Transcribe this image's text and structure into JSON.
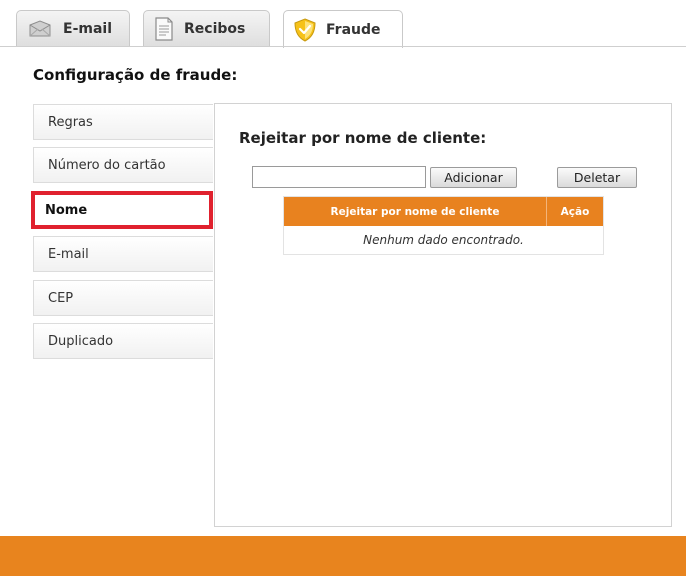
{
  "tabs": {
    "email": "E-mail",
    "recibos": "Recibos",
    "fraude": "Fraude"
  },
  "page": {
    "title": "Configuração de fraude:"
  },
  "sidebar": {
    "items": [
      {
        "label": "Regras"
      },
      {
        "label": "Número do cartão"
      },
      {
        "label": "Nome"
      },
      {
        "label": "E-mail"
      },
      {
        "label": "CEP"
      },
      {
        "label": "Duplicado"
      }
    ],
    "selected": "Nome"
  },
  "main": {
    "title": "Rejeitar por nome de cliente:",
    "input_value": "",
    "add_label": "Adicionar",
    "delete_label": "Deletar",
    "table": {
      "headers": [
        "Rejeitar por nome de cliente",
        "Ação"
      ],
      "empty_text": "Nenhum dado encontrado."
    }
  },
  "colors": {
    "accent": "#e8821f",
    "selection_border": "#e0212e"
  },
  "icons": {
    "email": "envelope-icon",
    "recibos": "document-icon",
    "fraude": "shield-icon"
  }
}
